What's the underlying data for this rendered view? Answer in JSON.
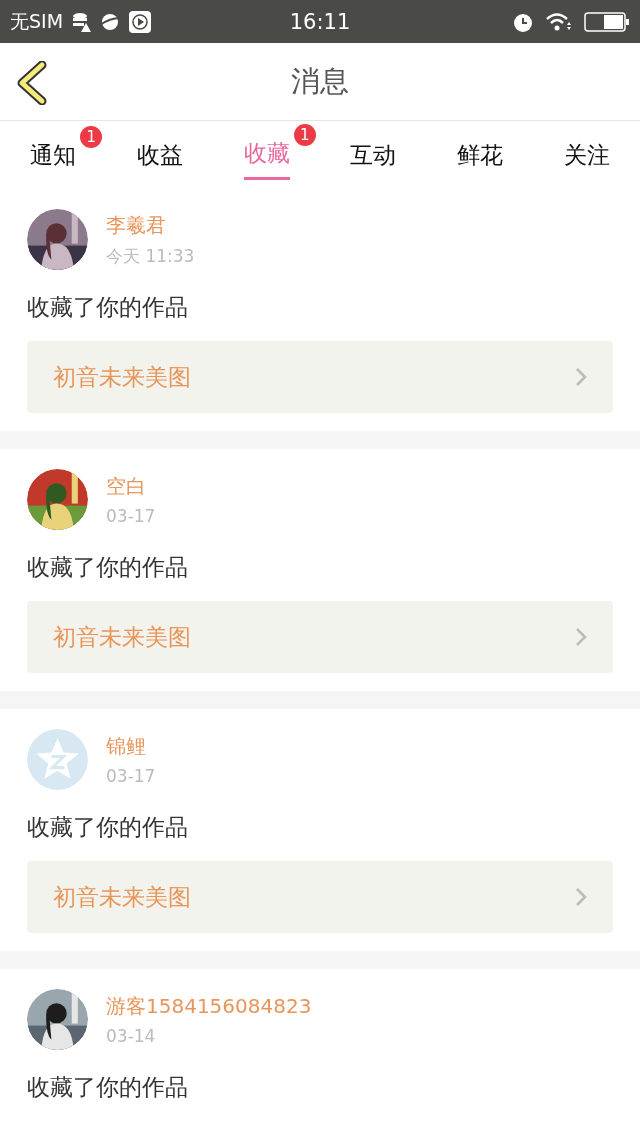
{
  "status_bar": {
    "carrier": "无SIM",
    "time": "16:11"
  },
  "header": {
    "title": "消息"
  },
  "tabs": [
    {
      "label": "通知",
      "selected": false,
      "badge": "1"
    },
    {
      "label": "收益",
      "selected": false
    },
    {
      "label": "收藏",
      "selected": true,
      "badge": "1"
    },
    {
      "label": "互动",
      "selected": false
    },
    {
      "label": "鲜花",
      "selected": false
    },
    {
      "label": "关注",
      "selected": false
    }
  ],
  "messages": [
    {
      "name": "李羲君",
      "time": "今天 11:33",
      "action": "收藏了你的作品",
      "work": "初音未来美图"
    },
    {
      "name": "空白",
      "time": "03-17",
      "action": "收藏了你的作品",
      "work": "初音未来美图"
    },
    {
      "avatar": {
        "kind": "default"
      },
      "name": "锦鲤",
      "time": "03-17",
      "action": "收藏了你的作品",
      "work": "初音未来美图"
    },
    {
      "name": "游客1584156084823",
      "time": "03-14",
      "action": "收藏了你的作品"
    }
  ]
}
